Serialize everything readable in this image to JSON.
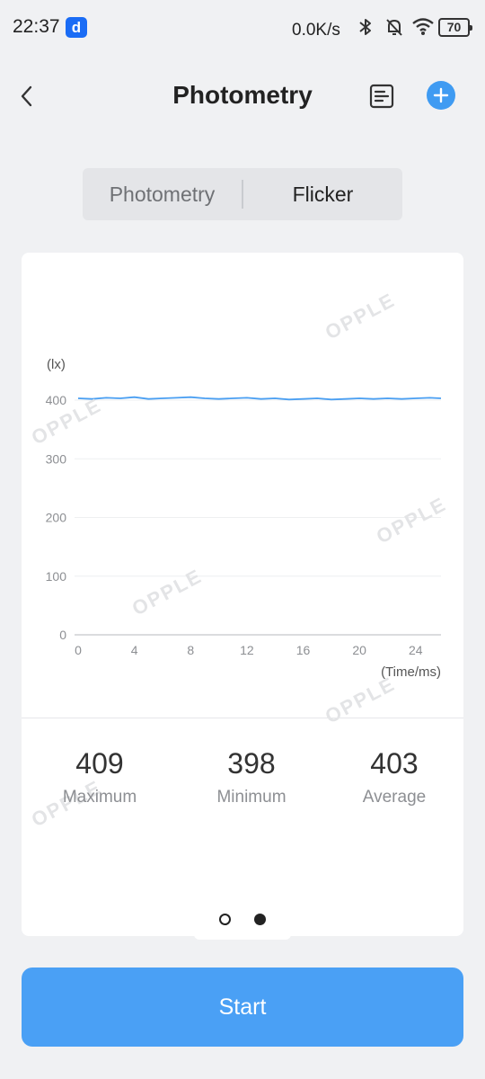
{
  "status_bar": {
    "time": "22:37",
    "app_badge": "d",
    "net_speed": "0.0K/s",
    "battery": "70"
  },
  "header": {
    "title": "Photometry",
    "back_icon": "chevron-left-icon",
    "report_icon": "report-icon",
    "add_icon": "plus-circle-icon"
  },
  "tabs": [
    {
      "label": "Photometry",
      "active": false
    },
    {
      "label": "Flicker",
      "active": true
    }
  ],
  "watermark": "OPPLE",
  "chart_data": {
    "type": "line",
    "ylabel": "(lx)",
    "xlabel": "(Time/ms)",
    "y_ticks": [
      0,
      100,
      200,
      300,
      400
    ],
    "x_ticks": [
      0,
      4,
      8,
      12,
      16,
      20,
      24
    ],
    "ylim": [
      0,
      400
    ],
    "xlim": [
      0,
      25.8
    ],
    "grid": true,
    "line_color": "#4a9ff2",
    "series": [
      {
        "x": [
          0,
          1,
          2,
          3,
          4,
          5,
          6,
          7,
          8,
          9,
          10,
          11,
          12,
          13,
          14,
          15,
          16,
          17,
          18,
          19,
          20,
          21,
          22,
          23,
          24,
          25,
          25.8
        ],
        "values": [
          403,
          402,
          404,
          403,
          405,
          402,
          403,
          404,
          405,
          403,
          402,
          403,
          404,
          402,
          403,
          401,
          402,
          403,
          401,
          402,
          403,
          402,
          403,
          402,
          403,
          404,
          403
        ]
      }
    ]
  },
  "stats": [
    {
      "value": "409",
      "label": "Maximum"
    },
    {
      "value": "398",
      "label": "Minimum"
    },
    {
      "value": "403",
      "label": "Average"
    }
  ],
  "pager": {
    "count": 2,
    "active": 2
  },
  "start_button": "Start"
}
